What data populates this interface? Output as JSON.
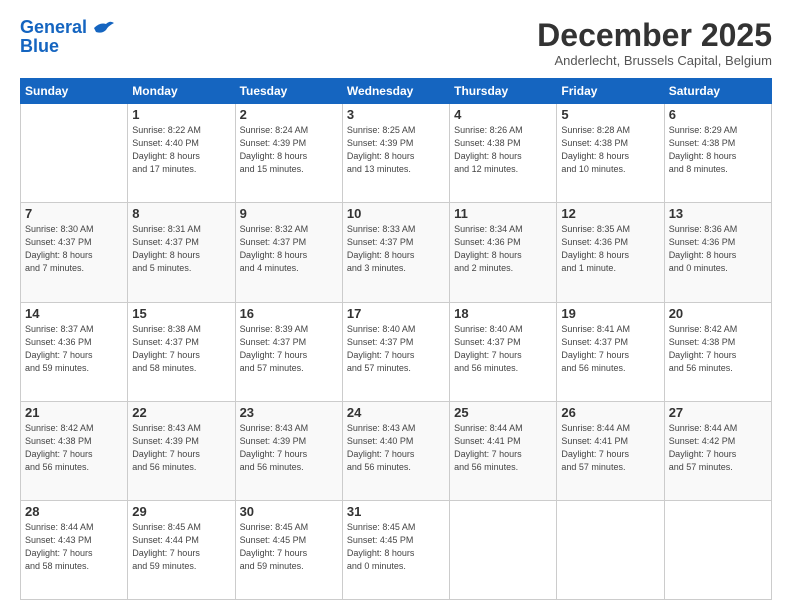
{
  "logo": {
    "line1": "General",
    "line2": "Blue"
  },
  "title": "December 2025",
  "subtitle": "Anderlecht, Brussels Capital, Belgium",
  "weekdays": [
    "Sunday",
    "Monday",
    "Tuesday",
    "Wednesday",
    "Thursday",
    "Friday",
    "Saturday"
  ],
  "weeks": [
    [
      {
        "day": "",
        "info": ""
      },
      {
        "day": "1",
        "info": "Sunrise: 8:22 AM\nSunset: 4:40 PM\nDaylight: 8 hours\nand 17 minutes."
      },
      {
        "day": "2",
        "info": "Sunrise: 8:24 AM\nSunset: 4:39 PM\nDaylight: 8 hours\nand 15 minutes."
      },
      {
        "day": "3",
        "info": "Sunrise: 8:25 AM\nSunset: 4:39 PM\nDaylight: 8 hours\nand 13 minutes."
      },
      {
        "day": "4",
        "info": "Sunrise: 8:26 AM\nSunset: 4:38 PM\nDaylight: 8 hours\nand 12 minutes."
      },
      {
        "day": "5",
        "info": "Sunrise: 8:28 AM\nSunset: 4:38 PM\nDaylight: 8 hours\nand 10 minutes."
      },
      {
        "day": "6",
        "info": "Sunrise: 8:29 AM\nSunset: 4:38 PM\nDaylight: 8 hours\nand 8 minutes."
      }
    ],
    [
      {
        "day": "7",
        "info": "Sunrise: 8:30 AM\nSunset: 4:37 PM\nDaylight: 8 hours\nand 7 minutes."
      },
      {
        "day": "8",
        "info": "Sunrise: 8:31 AM\nSunset: 4:37 PM\nDaylight: 8 hours\nand 5 minutes."
      },
      {
        "day": "9",
        "info": "Sunrise: 8:32 AM\nSunset: 4:37 PM\nDaylight: 8 hours\nand 4 minutes."
      },
      {
        "day": "10",
        "info": "Sunrise: 8:33 AM\nSunset: 4:37 PM\nDaylight: 8 hours\nand 3 minutes."
      },
      {
        "day": "11",
        "info": "Sunrise: 8:34 AM\nSunset: 4:36 PM\nDaylight: 8 hours\nand 2 minutes."
      },
      {
        "day": "12",
        "info": "Sunrise: 8:35 AM\nSunset: 4:36 PM\nDaylight: 8 hours\nand 1 minute."
      },
      {
        "day": "13",
        "info": "Sunrise: 8:36 AM\nSunset: 4:36 PM\nDaylight: 8 hours\nand 0 minutes."
      }
    ],
    [
      {
        "day": "14",
        "info": "Sunrise: 8:37 AM\nSunset: 4:36 PM\nDaylight: 7 hours\nand 59 minutes."
      },
      {
        "day": "15",
        "info": "Sunrise: 8:38 AM\nSunset: 4:37 PM\nDaylight: 7 hours\nand 58 minutes."
      },
      {
        "day": "16",
        "info": "Sunrise: 8:39 AM\nSunset: 4:37 PM\nDaylight: 7 hours\nand 57 minutes."
      },
      {
        "day": "17",
        "info": "Sunrise: 8:40 AM\nSunset: 4:37 PM\nDaylight: 7 hours\nand 57 minutes."
      },
      {
        "day": "18",
        "info": "Sunrise: 8:40 AM\nSunset: 4:37 PM\nDaylight: 7 hours\nand 56 minutes."
      },
      {
        "day": "19",
        "info": "Sunrise: 8:41 AM\nSunset: 4:37 PM\nDaylight: 7 hours\nand 56 minutes."
      },
      {
        "day": "20",
        "info": "Sunrise: 8:42 AM\nSunset: 4:38 PM\nDaylight: 7 hours\nand 56 minutes."
      }
    ],
    [
      {
        "day": "21",
        "info": "Sunrise: 8:42 AM\nSunset: 4:38 PM\nDaylight: 7 hours\nand 56 minutes."
      },
      {
        "day": "22",
        "info": "Sunrise: 8:43 AM\nSunset: 4:39 PM\nDaylight: 7 hours\nand 56 minutes."
      },
      {
        "day": "23",
        "info": "Sunrise: 8:43 AM\nSunset: 4:39 PM\nDaylight: 7 hours\nand 56 minutes."
      },
      {
        "day": "24",
        "info": "Sunrise: 8:43 AM\nSunset: 4:40 PM\nDaylight: 7 hours\nand 56 minutes."
      },
      {
        "day": "25",
        "info": "Sunrise: 8:44 AM\nSunset: 4:41 PM\nDaylight: 7 hours\nand 56 minutes."
      },
      {
        "day": "26",
        "info": "Sunrise: 8:44 AM\nSunset: 4:41 PM\nDaylight: 7 hours\nand 57 minutes."
      },
      {
        "day": "27",
        "info": "Sunrise: 8:44 AM\nSunset: 4:42 PM\nDaylight: 7 hours\nand 57 minutes."
      }
    ],
    [
      {
        "day": "28",
        "info": "Sunrise: 8:44 AM\nSunset: 4:43 PM\nDaylight: 7 hours\nand 58 minutes."
      },
      {
        "day": "29",
        "info": "Sunrise: 8:45 AM\nSunset: 4:44 PM\nDaylight: 7 hours\nand 59 minutes."
      },
      {
        "day": "30",
        "info": "Sunrise: 8:45 AM\nSunset: 4:45 PM\nDaylight: 7 hours\nand 59 minutes."
      },
      {
        "day": "31",
        "info": "Sunrise: 8:45 AM\nSunset: 4:45 PM\nDaylight: 8 hours\nand 0 minutes."
      },
      {
        "day": "",
        "info": ""
      },
      {
        "day": "",
        "info": ""
      },
      {
        "day": "",
        "info": ""
      }
    ]
  ]
}
